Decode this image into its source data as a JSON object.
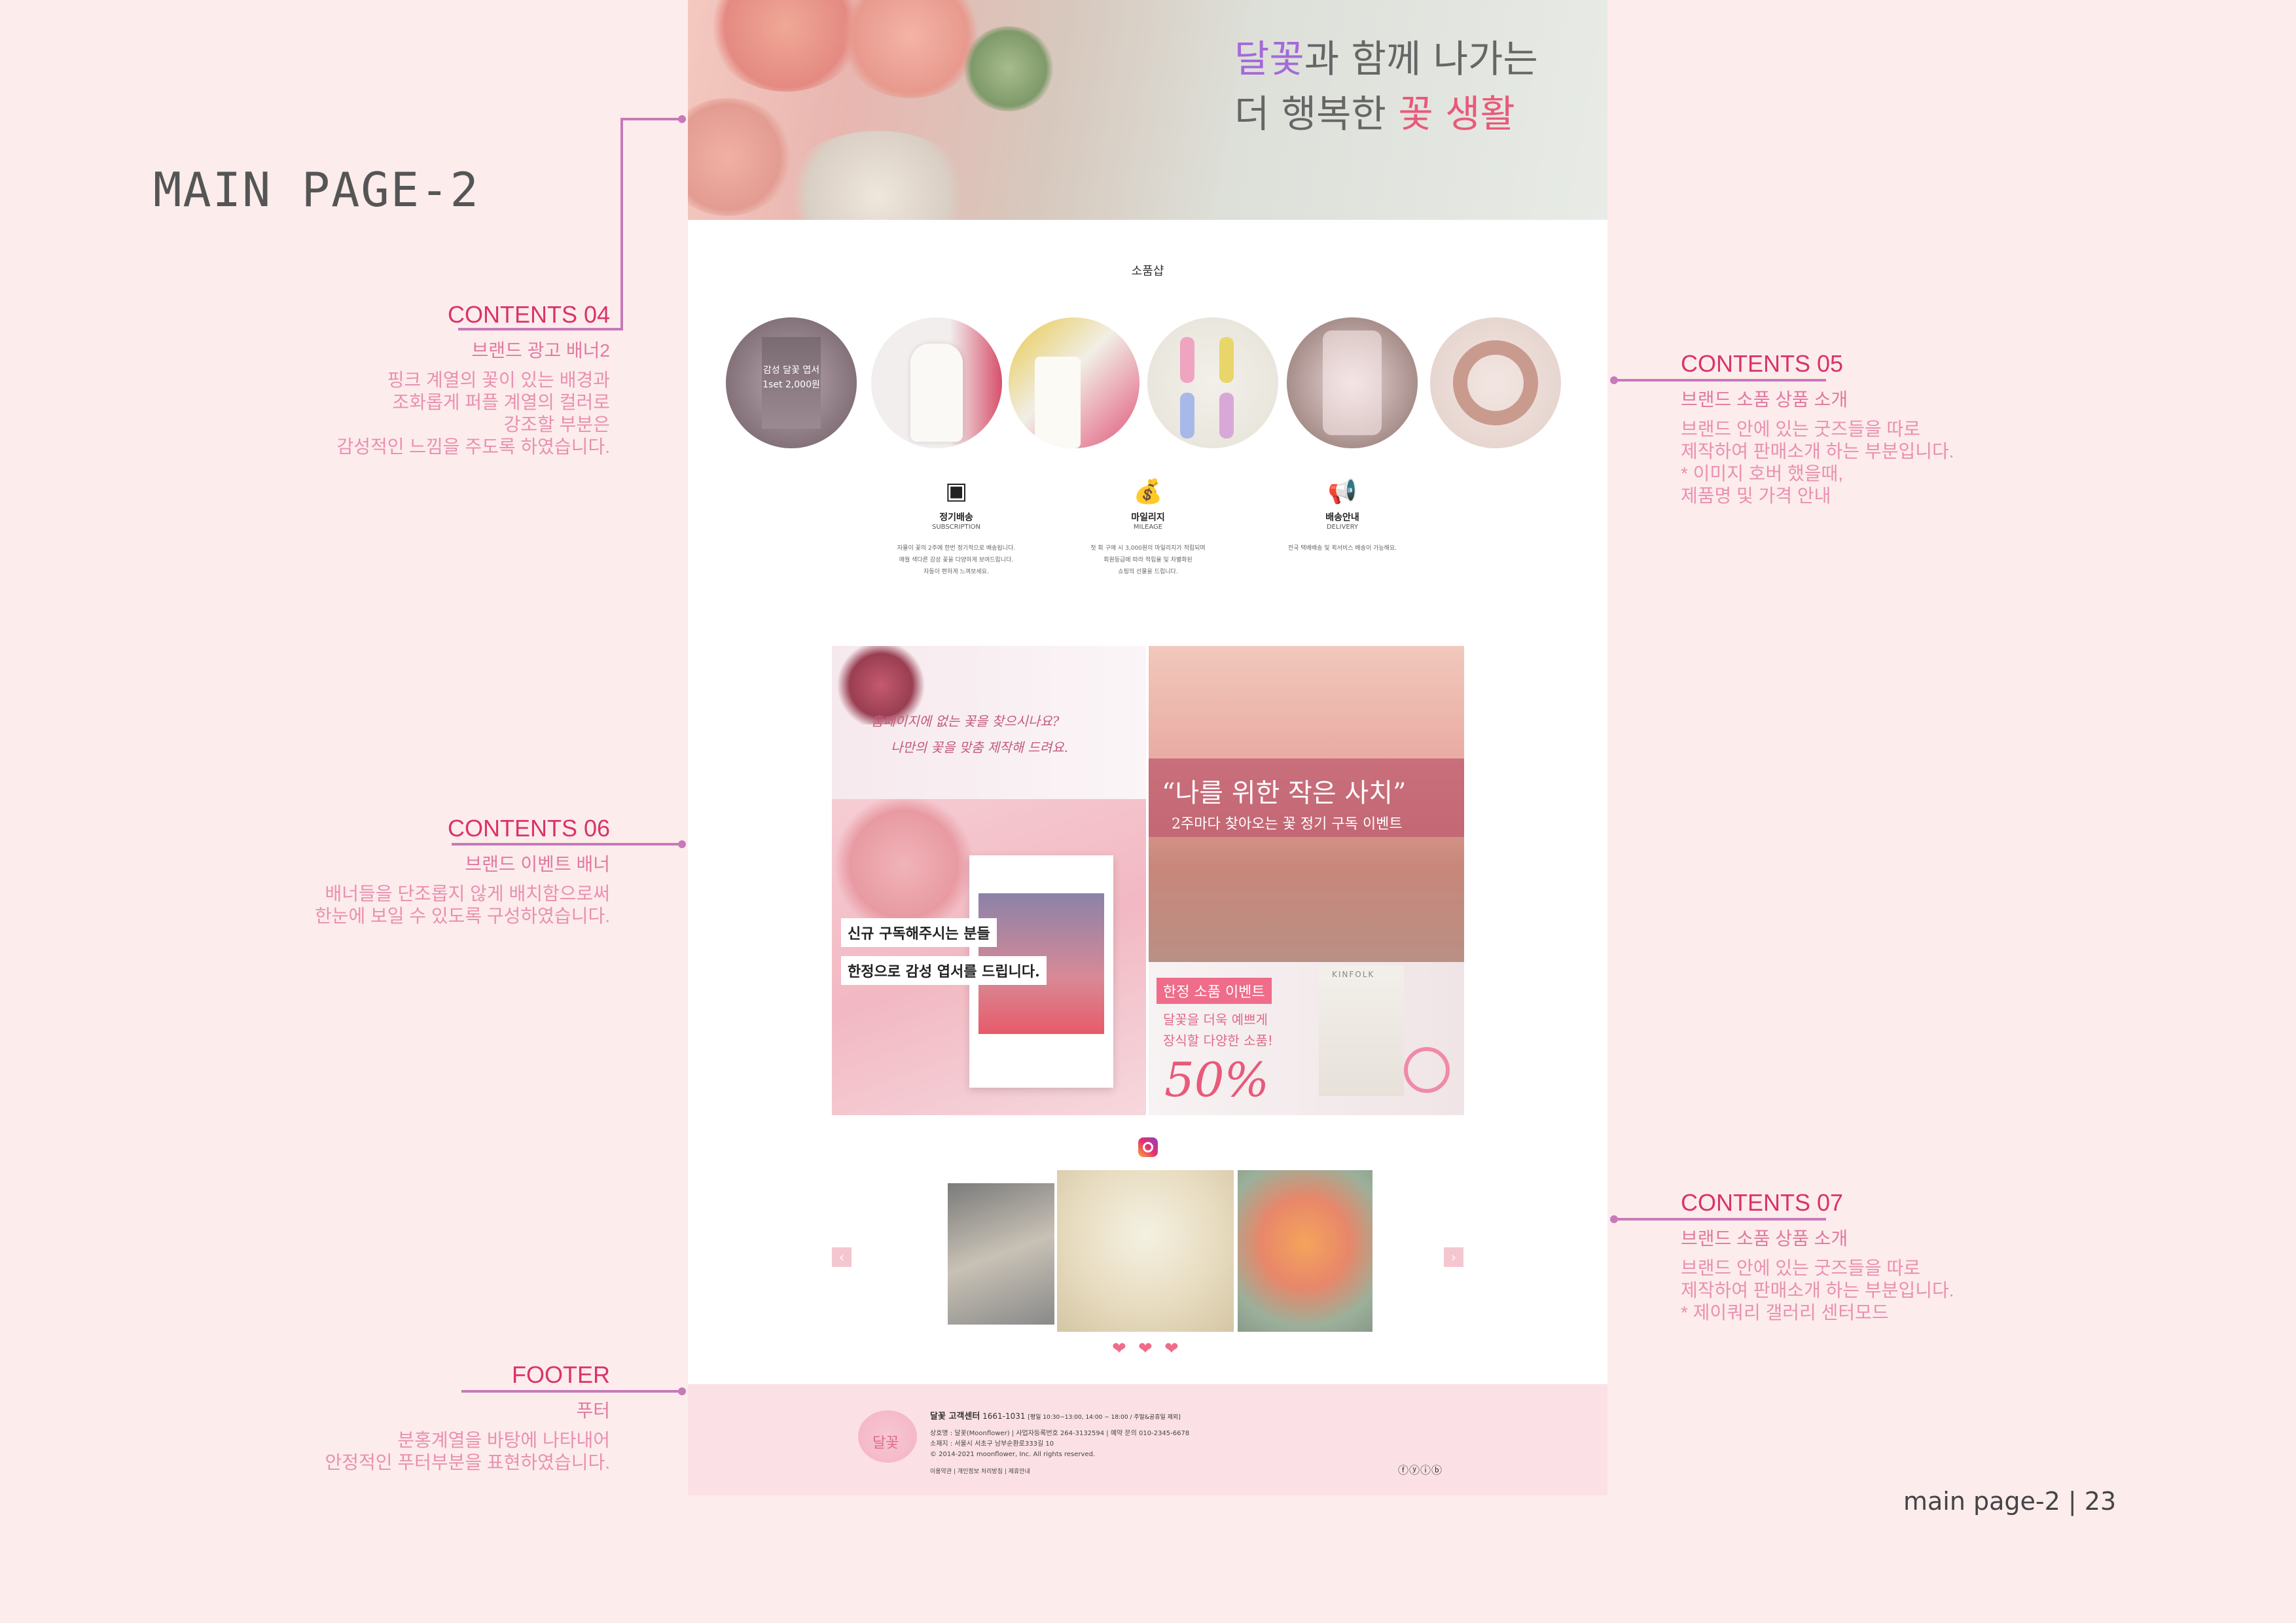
{
  "page_title": "MAIN PAGE-2",
  "annotations": {
    "c04": {
      "heading": "CONTENTS 04",
      "sub": "브랜드 광고  배너2",
      "lines": [
        "핑크 계열의 꽃이 있는 배경과",
        "조화롭게 퍼플 계열의 컬러로",
        "강조할 부분은",
        "감성적인 느낌을 주도록 하였습니다."
      ]
    },
    "c05": {
      "heading": "CONTENTS 05",
      "sub": "브랜드 소품 상품 소개",
      "lines": [
        "브랜드 안에 있는 굿즈들을 따로",
        "제작하여 판매소개 하는 부분입니다.",
        "* 이미지 호버 했을때,",
        "제품명 및 가격 안내"
      ]
    },
    "c06": {
      "heading": "CONTENTS 06",
      "sub": "브랜드 이벤트 배너",
      "lines": [
        "배너들을 단조롭지 않게 배치함으로써",
        "한눈에 보일 수 있도록 구성하였습니다."
      ]
    },
    "c07": {
      "heading": "CONTENTS 07",
      "sub": "브랜드 소품 상품 소개",
      "lines": [
        "브랜드 안에 있는 굿즈들을 따로",
        "제작하여 판매소개 하는 부분입니다.",
        "* 제이쿼리 갤러리 센터모드"
      ]
    },
    "footer": {
      "heading": "FOOTER",
      "sub": "푸터",
      "lines": [
        "분홍계열을 바탕에 나타내어",
        "안정적인 푸터부분을 표현하였습니다."
      ]
    }
  },
  "hero": {
    "line1_a": "달꽃",
    "line1_b": "과 함께 나가는",
    "line2_a": "더 행복한 ",
    "line2_b": "꽃 생활"
  },
  "shop": {
    "title": "소품샵",
    "hover_label_1": "감성 달꽃 엽서",
    "hover_label_2": "1set 2,000원"
  },
  "features": [
    {
      "icon": "box-icon",
      "glyph": "▣",
      "title": "정기배송",
      "sub": "SUBSCRIPTION",
      "desc1": "자물이 꽃의 2주에 한번 정기적으로 배송됩니다.",
      "desc2": "매월 색다른 감성 꽃을 다양하게 보여드립니다.",
      "desc3": "자동이 편하게 느껴보세요."
    },
    {
      "icon": "money-bag-icon",
      "glyph": "💰",
      "title": "마일리지",
      "sub": "MILEAGE",
      "desc1": "첫 회 구매 시 3,000원의 마일리지가 적립되며",
      "desc2": "회원등급에 따라 적립율 및 차별화된",
      "desc3": "쇼핑의 선물을 드립니다."
    },
    {
      "icon": "megaphone-icon",
      "glyph": "📢",
      "title": "배송안내",
      "sub": "DELIVERY",
      "desc1": "전국 택배배송 및 퀵서비스 배송이 가능해요.",
      "desc2": "",
      "desc3": ""
    }
  ],
  "banners": {
    "b1_line1": "홈페이지에 없는 꽃을 찾으시나요?",
    "b1_line2": "나만의 꽃을 맞춤 제작해 드려요.",
    "b2_line1": "신규 구독해주시는 분들",
    "b2_line2": "한정으로 감성 엽서를 드립니다.",
    "b3_title": "“나를 위한 작은 사치”",
    "b3_sub": "2주마다 찾아오는 꽃 정기 구독 이벤트",
    "b4_tag": "한정 소품 이벤트",
    "b4_sub1": "달꽃을 더욱 예쁘게",
    "b4_sub2": "장식할 다양한 소품!",
    "b4_big": "50%",
    "b4_brand": "KINFOLK"
  },
  "gallery": {
    "prev": "‹",
    "next": "›",
    "heart": "❤"
  },
  "footer": {
    "logo": "달꽃",
    "center": "달꽃 고객센터",
    "phone": "1661-1031",
    "hours": "[평일 10:30~13:00, 14:00 ~ 18:00 / 주말&공휴일 제외]",
    "info1": "상호명 : 달꽃(Moonflower)  |  사업자등록번호 264-3132594  |  예약 문의 010-2345-6678",
    "info2": "소재지 : 서울시 서초구 남부순환로333길 10",
    "copyright": "© 2014-2021 moonflower, Inc. All rights reserved.",
    "links": "이용약관  |  개인정보 처리방침  |  제휴안내",
    "sns": "ⓕⓨⓘⓑ"
  },
  "page_number": "main page-2 | 23",
  "colors": {
    "accent": "#d9336b",
    "line": "#c77ab8",
    "footer_bg": "#fbe1e6",
    "page_bg": "#fdecec"
  }
}
